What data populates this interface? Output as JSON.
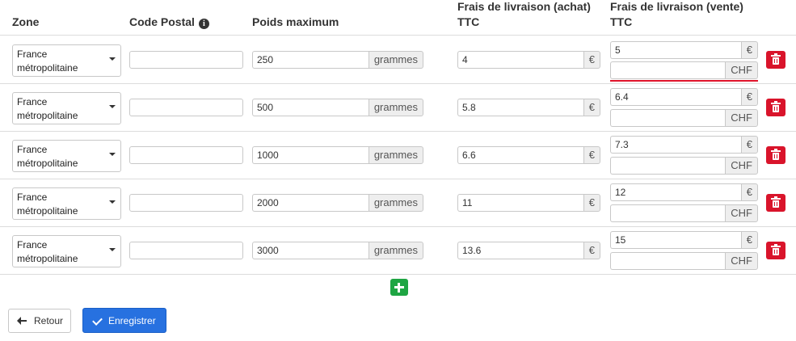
{
  "headers": {
    "zone": "Zone",
    "postal": "Code Postal",
    "weight": "Poids maximum",
    "purchase_line1": "Frais de livraison (achat)",
    "purchase_line2": "TTC",
    "sale_line1": "Frais de livraison (vente)",
    "sale_line2": "TTC"
  },
  "info_icon": "info-circle-icon",
  "units": {
    "weight": "grammes",
    "euro": "€",
    "chf": "CHF"
  },
  "rows": [
    {
      "zone_line1": "France",
      "zone_line2": "métropolitaine",
      "postal": "",
      "weight": "250",
      "purchase": "4",
      "sale_eur": "5",
      "sale_chf": ""
    },
    {
      "zone_line1": "France",
      "zone_line2": "métropolitaine",
      "postal": "",
      "weight": "500",
      "purchase": "5.8",
      "sale_eur": "6.4",
      "sale_chf": ""
    },
    {
      "zone_line1": "France",
      "zone_line2": "métropolitaine",
      "postal": "",
      "weight": "1000",
      "purchase": "6.6",
      "sale_eur": "7.3",
      "sale_chf": ""
    },
    {
      "zone_line1": "France",
      "zone_line2": "métropolitaine",
      "postal": "",
      "weight": "2000",
      "purchase": "11",
      "sale_eur": "12",
      "sale_chf": ""
    },
    {
      "zone_line1": "France",
      "zone_line2": "métropolitaine",
      "postal": "",
      "weight": "3000",
      "purchase": "13.6",
      "sale_eur": "15",
      "sale_chf": ""
    }
  ],
  "buttons": {
    "back": "Retour",
    "save": "Enregistrer"
  },
  "colors": {
    "delete": "#d9142b",
    "add": "#1ea543",
    "save": "#2771e0",
    "focus_underline": "#e0142b"
  }
}
